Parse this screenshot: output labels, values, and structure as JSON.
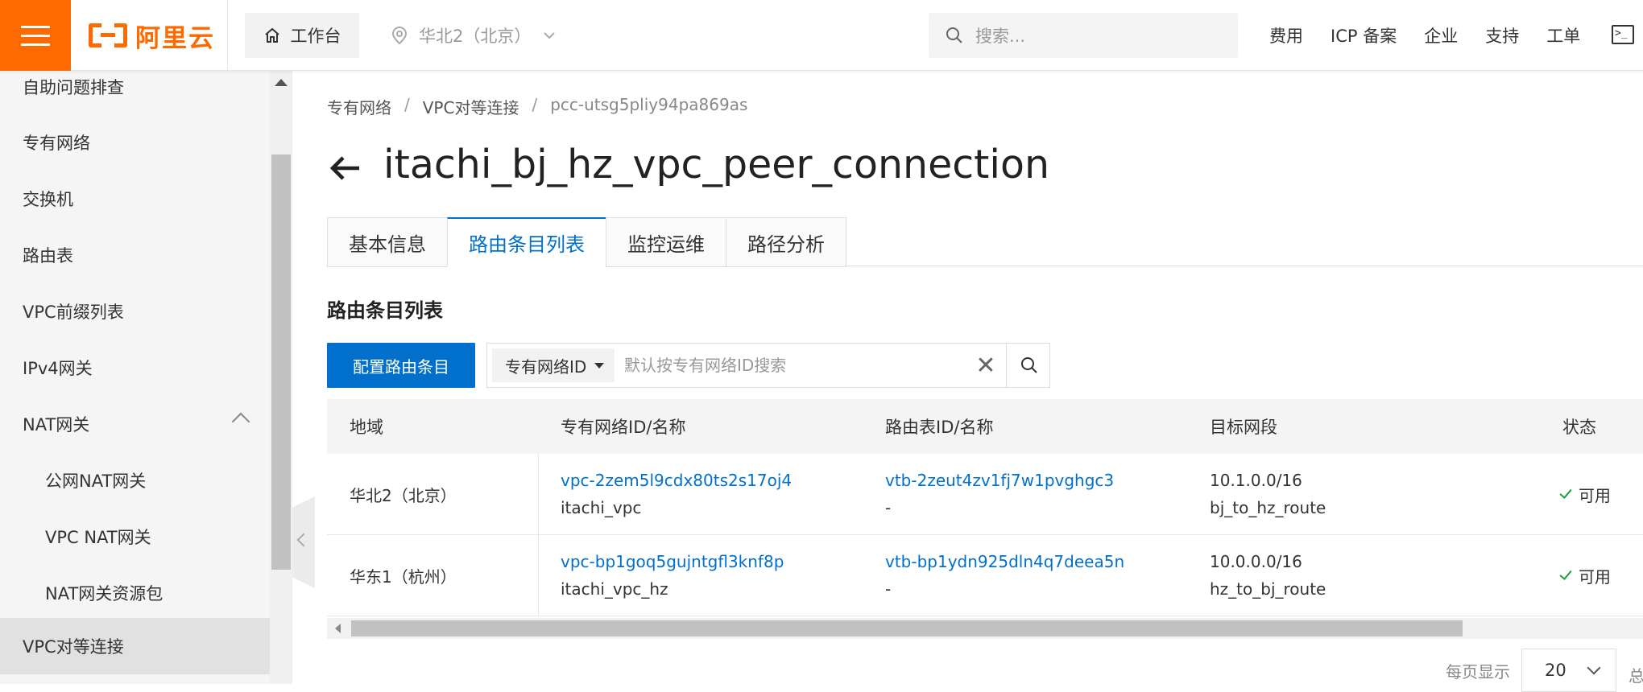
{
  "header": {
    "logo_text": "阿里云",
    "workbench_label": "工作台",
    "region_label": "华北2（北京）",
    "search_placeholder": "搜索...",
    "links": [
      "费用",
      "ICP 备案",
      "企业",
      "支持",
      "工单"
    ],
    "terminal_icon": ">_"
  },
  "sidebar": {
    "items": [
      {
        "label": "自助问题排查"
      },
      {
        "label": "专有网络"
      },
      {
        "label": "交换机"
      },
      {
        "label": "路由表"
      },
      {
        "label": "VPC前缀列表"
      },
      {
        "label": "IPv4网关"
      },
      {
        "label": "NAT网关"
      },
      {
        "label": "公网NAT网关"
      },
      {
        "label": "VPC NAT网关"
      },
      {
        "label": "NAT网关资源包"
      },
      {
        "label": "VPC对等连接"
      }
    ]
  },
  "breadcrumb": {
    "items": [
      "专有网络",
      "VPC对等连接",
      "pcc-utsg5pliy94pa869as"
    ],
    "separator": "/"
  },
  "page": {
    "title": "itachi_bj_hz_vpc_peer_connection",
    "tabs": [
      "基本信息",
      "路由条目列表",
      "监控运维",
      "路径分析"
    ],
    "section_title": "路由条目列表",
    "configure_button": "配置路由条目",
    "filter_select": "专有网络ID",
    "filter_placeholder": "默认按专有网络ID搜索",
    "clear_icon": "✕"
  },
  "table": {
    "headers": [
      "地域",
      "专有网络ID/名称",
      "路由表ID/名称",
      "目标网段",
      "状态"
    ],
    "rows": [
      {
        "region": "华北2（北京）",
        "vpc_id": "vpc-2zem5l9cdx80ts2s17oj4",
        "vpc_name": "itachi_vpc",
        "route_table_id": "vtb-2zeut4zv1fj7w1pvghgc3",
        "route_table_name": "-",
        "cidr": "10.1.0.0/16",
        "route_name": "bj_to_hz_route",
        "status": "可用"
      },
      {
        "region": "华东1（杭州）",
        "vpc_id": "vpc-bp1goq5gujntgfl3knf8p",
        "vpc_name": "itachi_vpc_hz",
        "route_table_id": "vtb-bp1ydn925dln4q7deea5n",
        "route_table_name": "-",
        "cidr": "10.0.0.0/16",
        "route_name": "hz_to_bj_route",
        "status": "可用"
      }
    ]
  },
  "pager": {
    "per_page_label": "每页显示",
    "per_page_value": "20",
    "total_prefix": "总"
  },
  "colors": {
    "brand": "#ff6a00",
    "primary": "#0070cc",
    "success": "#1e9e39"
  }
}
